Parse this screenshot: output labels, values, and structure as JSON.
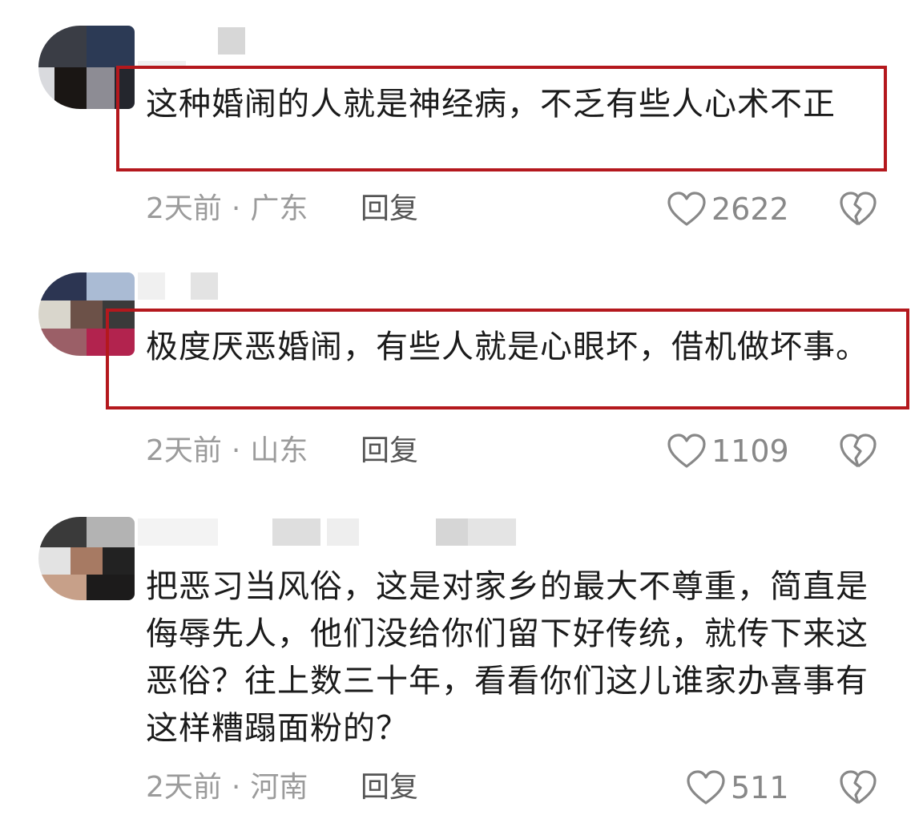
{
  "comments": [
    {
      "text": "这种婚闹的人就是神经病，不乏有些人心术不正",
      "time": "2天前",
      "separator": "·",
      "location": "广东",
      "reply_label": "回复",
      "likes": "2622"
    },
    {
      "text": "极度厌恶婚闹，有些人就是心眼坏，借机做坏事。",
      "time": "2天前",
      "separator": "·",
      "location": "山东",
      "reply_label": "回复",
      "likes": "1109"
    },
    {
      "text": "把恶习当风俗，这是对家乡的最大不尊重，简直是侮辱先人，他们没给你们留下好传统，就传下来这恶俗？往上数三十年，看看你们这儿谁家办喜事有这样糟蹋面粉的？",
      "time": "2天前",
      "separator": "·",
      "location": "河南",
      "reply_label": "回复",
      "likes": "511"
    }
  ],
  "colors": {
    "highlight_border": "#b4181d",
    "meta_text": "#9b9b9b",
    "reply_text": "#555555",
    "icon_stroke": "#888888"
  },
  "icons": {
    "like": "heart-outline-icon",
    "dislike": "broken-heart-icon"
  }
}
